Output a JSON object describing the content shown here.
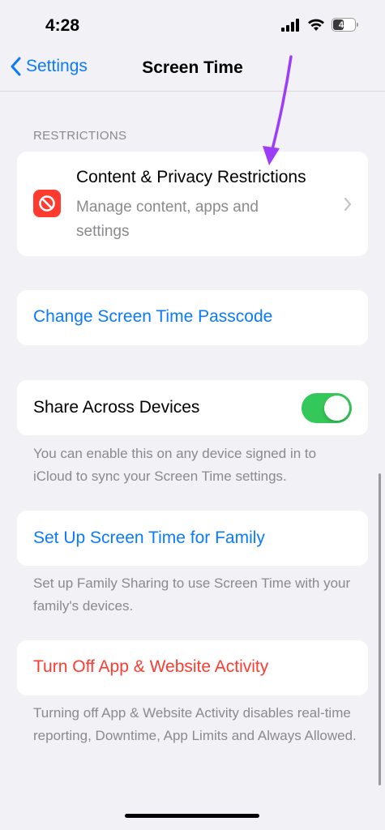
{
  "status_bar": {
    "time": "4:28",
    "battery_level": "47"
  },
  "nav": {
    "back_label": "Settings",
    "title": "Screen Time"
  },
  "restrictions": {
    "header": "RESTRICTIONS",
    "title": "Content & Privacy Restrictions",
    "subtitle": "Manage content, apps and settings",
    "icon_color": "#ff3b30"
  },
  "passcode": {
    "label": "Change Screen Time Passcode"
  },
  "share": {
    "label": "Share Across Devices",
    "toggle_on": true,
    "footnote": "You can enable this on any device signed in to iCloud to sync your Screen Time settings."
  },
  "family": {
    "label": "Set Up Screen Time for Family",
    "footnote": "Set up Family Sharing to use Screen Time with your family's devices."
  },
  "turn_off": {
    "label": "Turn Off App & Website Activity",
    "footnote": "Turning off App & Website Activity disables real-time reporting, Downtime, App Limits and Always Allowed."
  },
  "colors": {
    "accent": "#0a7aff",
    "danger": "#ff3b30",
    "toggle_on": "#34c759",
    "annotation_arrow": "#9b3dfa"
  }
}
